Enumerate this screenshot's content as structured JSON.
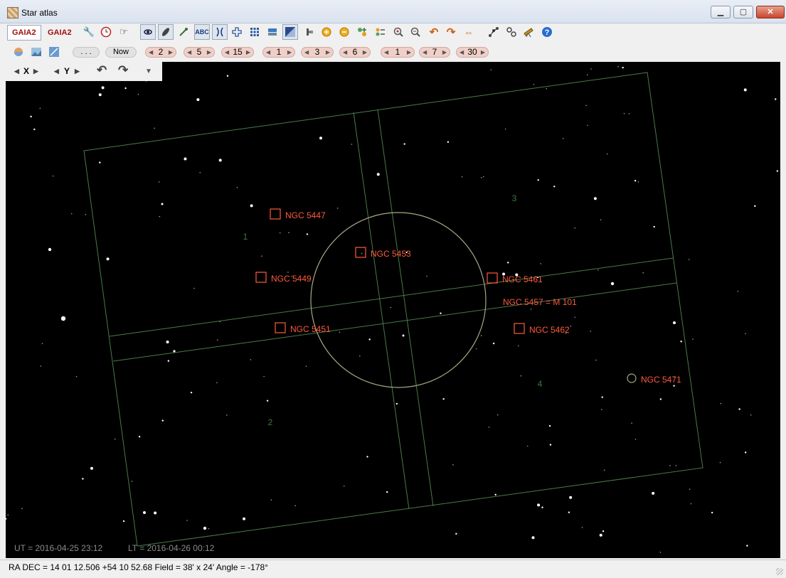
{
  "window": {
    "title": "Star atlas",
    "min_label": "▁",
    "max_label": "▢",
    "close_label": "✕"
  },
  "toolbar": {
    "catalog1": "GAIA2",
    "catalog2": "GAIA2",
    "text_label_button": "ABC",
    "icons": [
      "tools-icon",
      "clock-icon",
      "hand-pointer-icon",
      "galaxy-icon",
      "nebula-icon",
      "comet-icon",
      "text-label-icon",
      "constellation-icon",
      "crosshair-icon",
      "grid-icon",
      "horizon-icon",
      "milkyway-icon",
      "scale-icon",
      "zoom-in-icon",
      "zoom-out-icon",
      "add-marker-icon",
      "list-icon",
      "find-icon",
      "unzoom-icon",
      "undo-icon",
      "redo-icon",
      "flip-icon",
      "chart-link-icon",
      "settings-icon",
      "telescope-icon",
      "help-icon"
    ]
  },
  "toolbar2": {
    "more_label": ". . .",
    "now_label": "Now",
    "steps": [
      "2",
      "5",
      "15",
      "1",
      "3",
      "6",
      "1",
      "7",
      "30"
    ]
  },
  "orientation": {
    "x_label": "X",
    "y_label": "Y"
  },
  "sky": {
    "objects": [
      {
        "name": "NGC 5447"
      },
      {
        "name": "NGC 5453"
      },
      {
        "name": "NGC 5449"
      },
      {
        "name": "NGC 5461"
      },
      {
        "name": "NGC 5457 = M 101"
      },
      {
        "name": "NGC 5451"
      },
      {
        "name": "NGC 5462"
      },
      {
        "name": "NGC 5471"
      }
    ],
    "quadrants": [
      "1",
      "2",
      "3",
      "4"
    ],
    "label_color": "#ff5a3c",
    "frame_color": "#4a7a4a",
    "circle_color": "#a8a888"
  },
  "time": {
    "ut": "UT = 2016-04-25  23:12",
    "lt": "LT = 2016-04-26  00:12"
  },
  "status": {
    "text": "RA DEC  =  14 01 12.506 +54 10 52.68  Field  =  38' x 24'  Angle  =  -178°"
  }
}
